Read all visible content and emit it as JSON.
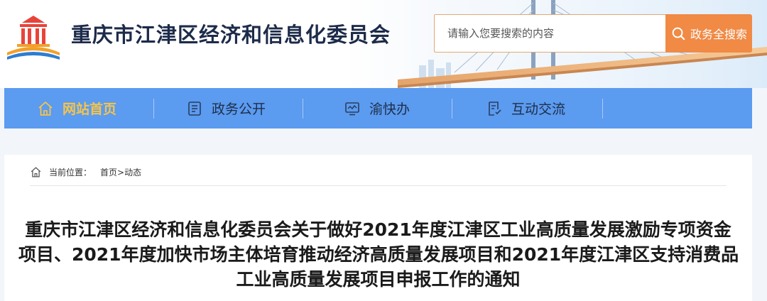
{
  "header": {
    "site_title": "重庆市江津区经济和信息化委员会",
    "logo_icon": "government-building-logo-icon",
    "background_image": "bridge-illustration"
  },
  "search": {
    "placeholder": "请输入您要搜索的内容",
    "button_label": "政务全搜索",
    "button_icon": "search-icon",
    "button_color": "#f08a45"
  },
  "nav": {
    "background": "#5b9bf0",
    "active_color": "#f5c44a",
    "items": [
      {
        "label": "网站首页",
        "icon": "home-icon",
        "active": true
      },
      {
        "label": "政务公开",
        "icon": "document-icon",
        "active": false
      },
      {
        "label": "渝快办",
        "icon": "monitor-icon",
        "active": false
      },
      {
        "label": "互动交流",
        "icon": "feedback-icon",
        "active": false
      }
    ]
  },
  "breadcrumb": {
    "prefix": "当前位置：",
    "items": [
      "首页",
      ">",
      "动态"
    ]
  },
  "article": {
    "title_lines": [
      "重庆市江津区经济和信息化委员会关于做好2021年度江津区工业高质量发展激励专项资金",
      "项目、2021年度加快市场主体培育推动经济高质量发展项目和2021年度江津区支持消费品",
      "工业高质量发展项目申报工作的通知"
    ]
  }
}
